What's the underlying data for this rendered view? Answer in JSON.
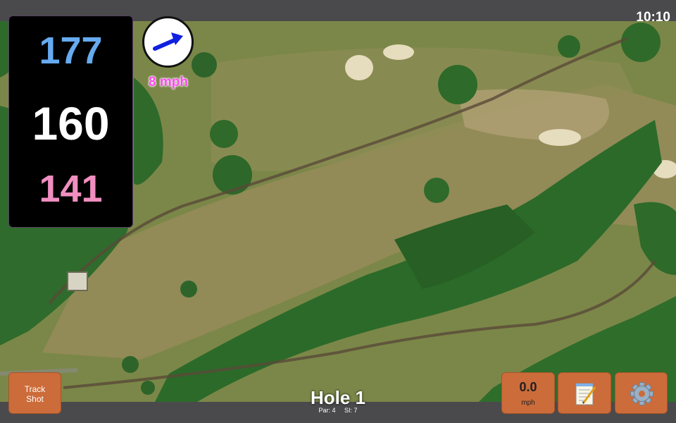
{
  "status_bar": {
    "time": "10:10"
  },
  "yardages": {
    "back": "177",
    "center": "160",
    "front": "141"
  },
  "wind": {
    "speed_text": "8 mph",
    "direction_icon": "wind-arrow-icon",
    "arrow_color": "#1020e0"
  },
  "hole": {
    "title": "Hole 1",
    "par_text": "Par: 4",
    "si_text": "SI: 7"
  },
  "buttons": {
    "track_shot_line1": "Track",
    "track_shot_line2": "Shot",
    "speed_value": "0.0",
    "speed_unit": "mph",
    "notes_icon": "notepad-icon",
    "settings_icon": "gear-icon"
  },
  "colors": {
    "back_yardage": "#66aaf0",
    "center_yardage": "#ffffff",
    "front_yardage": "#f08ec0",
    "wind_text": "#ff48f0",
    "button_bg": "#cc6c3a"
  }
}
